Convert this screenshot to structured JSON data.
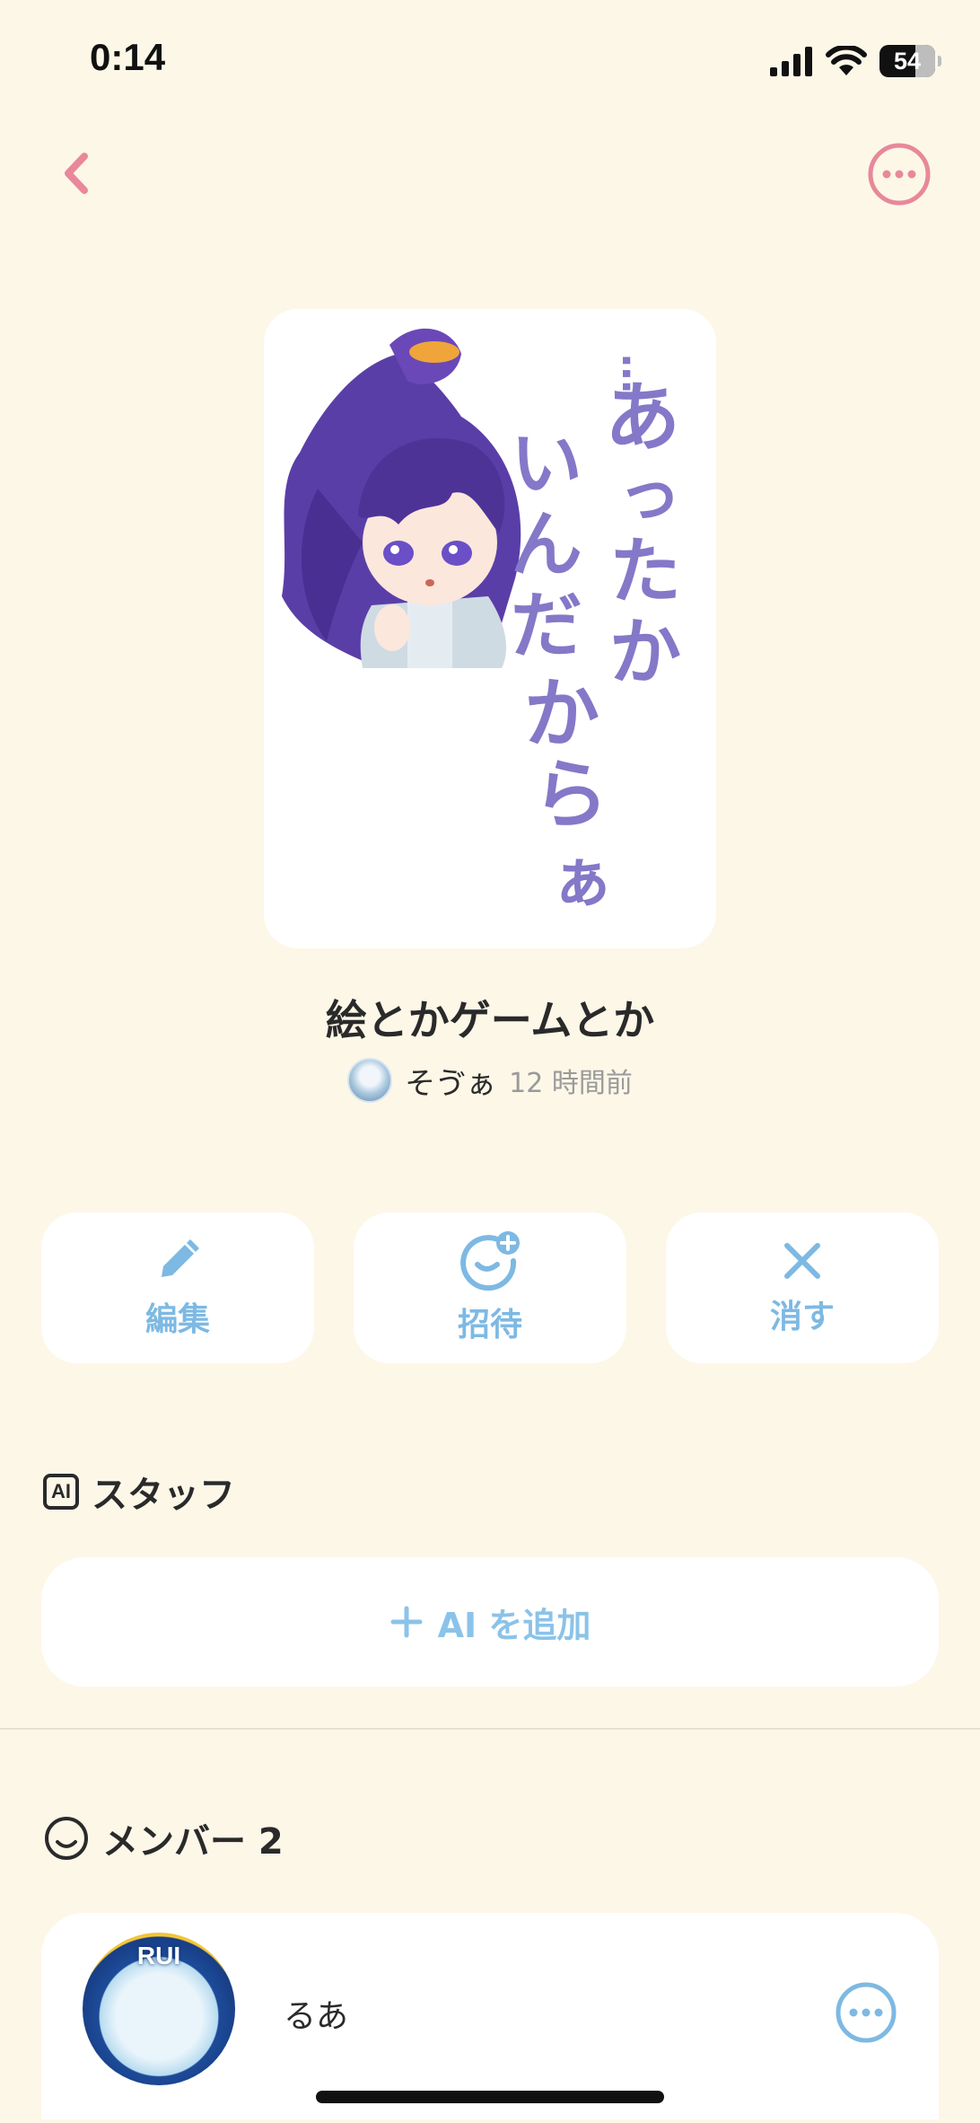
{
  "status_bar": {
    "time": "0:14",
    "battery": "54"
  },
  "header": {
    "back_icon": "chevron-left-icon",
    "more_icon": "ellipsis-circle-icon",
    "accent_color": "#E8889A"
  },
  "room": {
    "cover_text": "…あったかいんだからぁ",
    "title": "絵とかゲームとか",
    "owner_name": "そゔぁ",
    "updated": "12 時間前"
  },
  "actions": [
    {
      "label": "編集",
      "icon": "pencil-icon"
    },
    {
      "label": "招待",
      "icon": "add-friend-icon"
    },
    {
      "label": "消す",
      "icon": "close-icon"
    }
  ],
  "staff": {
    "badge": "AI",
    "heading": "スタッフ",
    "add_label": "AI を追加"
  },
  "members": {
    "heading": "メンバー 2",
    "list": [
      {
        "name": "るあ",
        "avatar_text": "RUI"
      }
    ]
  },
  "colors": {
    "background": "#FDF7E8",
    "action_blue": "#7DB9E3",
    "card": "#FFFFFF"
  }
}
